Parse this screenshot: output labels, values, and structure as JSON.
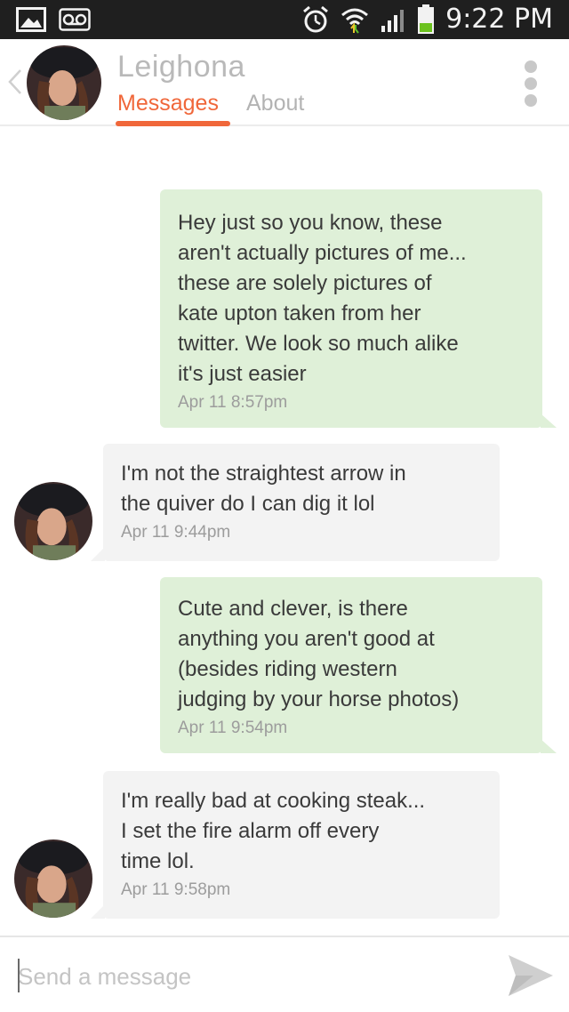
{
  "status_bar": {
    "time": "9:22 PM",
    "icons": [
      "gallery-icon",
      "voicemail-icon",
      "alarm-icon",
      "wifi-icon",
      "signal-icon",
      "battery-icon"
    ]
  },
  "header": {
    "name": "Leighona",
    "tabs": [
      {
        "label": "Messages",
        "active": true
      },
      {
        "label": "About",
        "active": false
      }
    ],
    "accent_color": "#f0673a"
  },
  "messages": [
    {
      "direction": "outgoing",
      "lines": [
        "Hey just so you know, these",
        "aren't actually pictures of me...",
        "these are solely pictures of",
        "kate upton taken from her",
        "twitter. We look so much alike",
        "it's just easier"
      ],
      "time": "Apr 11 8:57pm"
    },
    {
      "direction": "incoming",
      "lines": [
        "I'm not the straightest arrow in",
        "the quiver do I can dig it lol"
      ],
      "time": "Apr 11 9:44pm"
    },
    {
      "direction": "outgoing",
      "lines": [
        "Cute and clever, is there",
        "anything you aren't good at",
        "(besides riding western",
        "judging by your horse photos)"
      ],
      "time": "Apr 11 9:54pm"
    },
    {
      "direction": "incoming",
      "lines": [
        "I'm really bad at cooking steak...",
        "I set the fire alarm off every",
        "time lol."
      ],
      "time": "Apr 11 9:58pm"
    }
  ],
  "composer": {
    "placeholder": "Send a message",
    "value": ""
  },
  "colors": {
    "outgoing_bubble": "#dff0d8",
    "incoming_bubble": "#f3f3f3",
    "status_bar": "#1f1f1f"
  }
}
